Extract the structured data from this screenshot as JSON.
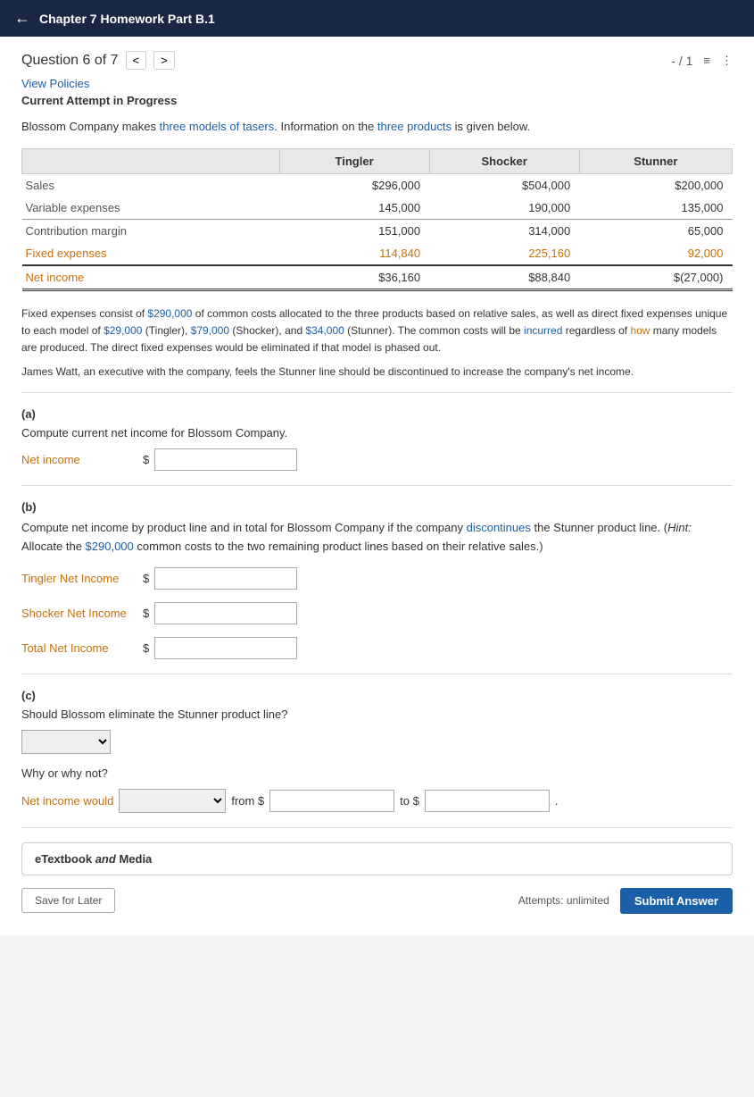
{
  "topbar": {
    "back_label": "←",
    "title": "Chapter 7 Homework Part B.1"
  },
  "header": {
    "question_label": "Question 6 of 7",
    "prev_btn": "<",
    "next_btn": ">",
    "score": "- / 1",
    "list_icon": "≡",
    "more_icon": "⋮"
  },
  "view_policies": "View Policies",
  "current_attempt": "Current Attempt in Progress",
  "problem": {
    "intro": "Blossom Company makes three models of tasers. Information on the three products is given below.",
    "table": {
      "headers": [
        "",
        "Tingler",
        "Shocker",
        "Stunner"
      ],
      "rows": [
        {
          "label": "Sales",
          "tingler": "$296,000",
          "shocker": "$504,000",
          "stunner": "$200,000"
        },
        {
          "label": "Variable expenses",
          "tingler": "145,000",
          "shocker": "190,000",
          "stunner": "135,000"
        },
        {
          "label": "Contribution margin",
          "tingler": "151,000",
          "shocker": "314,000",
          "stunner": "65,000"
        },
        {
          "label": "Fixed expenses",
          "tingler": "114,840",
          "shocker": "225,160",
          "stunner": "92,000"
        },
        {
          "label": "Net income",
          "tingler": "$36,160",
          "shocker": "$88,840",
          "stunner": "$(27,000)"
        }
      ]
    },
    "fixed_expenses_text": "Fixed expenses consist of $290,000 of common costs allocated to the three products based on relative sales, as well as direct fixed expenses unique to each model of $29,000 (Tingler), $79,000 (Shocker), and $34,000 (Stunner). The common costs will be incurred regardless of how many models are produced. The direct fixed expenses would be eliminated if that model is phased out.",
    "james_watt_text": "James Watt, an executive with the company, feels the Stunner line should be discontinued to increase the company's net income."
  },
  "section_a": {
    "label": "(a)",
    "compute_text": "Compute current net income for Blossom Company.",
    "net_income_label": "Net income",
    "dollar_sign": "$",
    "input_placeholder": ""
  },
  "section_b": {
    "label": "(b)",
    "compute_text": "Compute net income by product line and in total for Blossom Company if the company discontinues the Stunner product line. (Hint: Allocate the $290,000 common costs to the two remaining product lines based on their relative sales.)",
    "tingler_label": "Tingler Net Income",
    "shocker_label": "Shocker Net Income",
    "total_label": "Total Net Income",
    "dollar_sign": "$"
  },
  "section_c": {
    "label": "(c)",
    "question": "Should Blossom eliminate the Stunner product line?",
    "why_label": "Why or why not?",
    "net_income_would_label": "Net income would",
    "from_label": "from $",
    "to_label": "to $",
    "period": "."
  },
  "etextbook": {
    "text": "eTextbook",
    "and_text": "and",
    "media_text": "Media"
  },
  "footer": {
    "save_later": "Save for Later",
    "attempts_text": "Attempts: unlimited",
    "submit_label": "Submit Answer"
  }
}
